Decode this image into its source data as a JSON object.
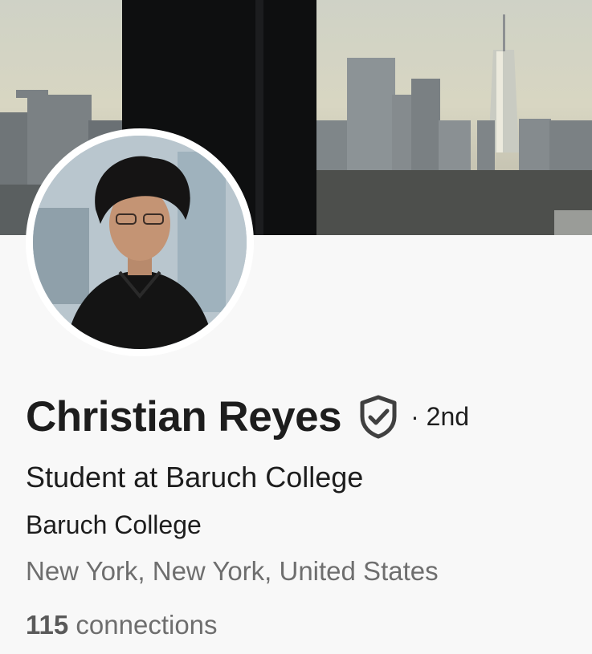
{
  "profile": {
    "name": "Christian Reyes",
    "degree": "· 2nd",
    "headline": "Student at Baruch College",
    "school": "Baruch College",
    "location": "New York, New York, United States",
    "connections_count": "115",
    "connections_label": " connections"
  },
  "icons": {
    "verified": "shield-check-icon"
  },
  "colors": {
    "text_primary": "#1d1d1d",
    "text_secondary": "#6e6e6e",
    "background": "#f8f8f8"
  }
}
